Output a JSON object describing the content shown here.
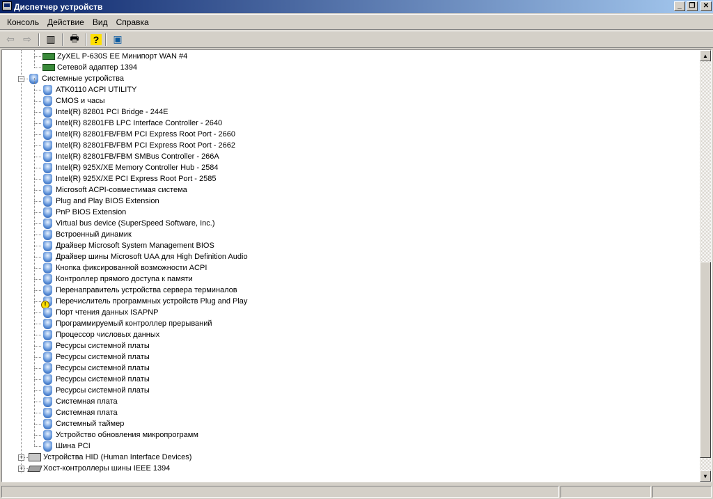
{
  "window": {
    "title": "Диспетчер устройств",
    "buttons": [
      "_",
      "❐",
      "✕"
    ]
  },
  "menu": [
    "Консоль",
    "Действие",
    "Вид",
    "Справка"
  ],
  "toolbar": [
    {
      "icon": "back-icon",
      "glyph": "⇦"
    },
    {
      "icon": "forward-icon",
      "glyph": "⇨"
    },
    {
      "icon": "show-hide-tree-icon",
      "glyph": "▥"
    },
    {
      "icon": "print-icon",
      "glyph": "🖶"
    },
    {
      "icon": "help-icon",
      "glyph": "?"
    },
    {
      "icon": "properties-icon",
      "glyph": "▣"
    }
  ],
  "tree": [
    {
      "level": 2,
      "icon": "net",
      "label": "ZyXEL P-630S EE Минипорт WAN #4"
    },
    {
      "level": 2,
      "icon": "net",
      "label": "Сетевой адаптер 1394"
    },
    {
      "level": 1,
      "icon": "dev",
      "label": "Системные устройства",
      "expanded": true
    },
    {
      "level": 2,
      "icon": "dev",
      "label": "ATK0110 ACPI UTILITY"
    },
    {
      "level": 2,
      "icon": "dev",
      "label": "CMOS и часы"
    },
    {
      "level": 2,
      "icon": "dev",
      "label": "Intel(R) 82801 PCI Bridge - 244E"
    },
    {
      "level": 2,
      "icon": "dev",
      "label": "Intel(R) 82801FB LPC Interface Controller - 2640"
    },
    {
      "level": 2,
      "icon": "dev",
      "label": "Intel(R) 82801FB/FBM PCI Express Root Port - 2660"
    },
    {
      "level": 2,
      "icon": "dev",
      "label": "Intel(R) 82801FB/FBM PCI Express Root Port - 2662"
    },
    {
      "level": 2,
      "icon": "dev",
      "label": "Intel(R) 82801FB/FBM SMBus Controller - 266A"
    },
    {
      "level": 2,
      "icon": "dev",
      "label": "Intel(R) 925X/XE Memory Controller Hub - 2584"
    },
    {
      "level": 2,
      "icon": "dev",
      "label": "Intel(R) 925X/XE PCI Express Root Port - 2585"
    },
    {
      "level": 2,
      "icon": "dev",
      "label": "Microsoft ACPI-совместимая система"
    },
    {
      "level": 2,
      "icon": "dev",
      "label": "Plug and Play BIOS Extension"
    },
    {
      "level": 2,
      "icon": "dev",
      "label": "PnP BIOS Extension"
    },
    {
      "level": 2,
      "icon": "dev",
      "label": "Virtual bus device (SuperSpeed Software, Inc.)"
    },
    {
      "level": 2,
      "icon": "dev",
      "label": "Встроенный динамик"
    },
    {
      "level": 2,
      "icon": "dev",
      "label": "Драйвер Microsoft System Management BIOS"
    },
    {
      "level": 2,
      "icon": "dev",
      "label": "Драйвер шины Microsoft UAA для High Definition Audio"
    },
    {
      "level": 2,
      "icon": "dev",
      "label": "Кнопка фиксированной возможности ACPI"
    },
    {
      "level": 2,
      "icon": "dev",
      "label": "Контроллер прямого доступа к памяти"
    },
    {
      "level": 2,
      "icon": "dev",
      "label": "Перенаправитель устройства сервера терминалов"
    },
    {
      "level": 2,
      "icon": "dev warn",
      "label": "Перечислитель программных устройств Plug and Play"
    },
    {
      "level": 2,
      "icon": "dev",
      "label": "Порт чтения данных ISAPNP"
    },
    {
      "level": 2,
      "icon": "dev",
      "label": "Программируемый контроллер прерываний"
    },
    {
      "level": 2,
      "icon": "dev",
      "label": "Процессор числовых данных"
    },
    {
      "level": 2,
      "icon": "dev",
      "label": "Ресурсы системной платы"
    },
    {
      "level": 2,
      "icon": "dev",
      "label": "Ресурсы системной платы"
    },
    {
      "level": 2,
      "icon": "dev",
      "label": "Ресурсы системной платы"
    },
    {
      "level": 2,
      "icon": "dev",
      "label": "Ресурсы системной платы"
    },
    {
      "level": 2,
      "icon": "dev",
      "label": "Ресурсы системной платы"
    },
    {
      "level": 2,
      "icon": "dev",
      "label": "Системная плата"
    },
    {
      "level": 2,
      "icon": "dev",
      "label": "Системная плата"
    },
    {
      "level": 2,
      "icon": "dev",
      "label": "Системный таймер"
    },
    {
      "level": 2,
      "icon": "dev",
      "label": "Устройство обновления микропрограмм"
    },
    {
      "level": 2,
      "icon": "dev",
      "label": "Шина PCI"
    },
    {
      "level": 1,
      "icon": "hid",
      "label": "Устройства HID (Human Interface Devices)",
      "expanded": false
    },
    {
      "level": 1,
      "icon": "ieee",
      "label": "Хост-контроллеры шины IEEE 1394",
      "expanded": false
    }
  ],
  "scrollbar": {
    "position_fraction": 0.49,
    "visible_fraction": 0.48
  }
}
